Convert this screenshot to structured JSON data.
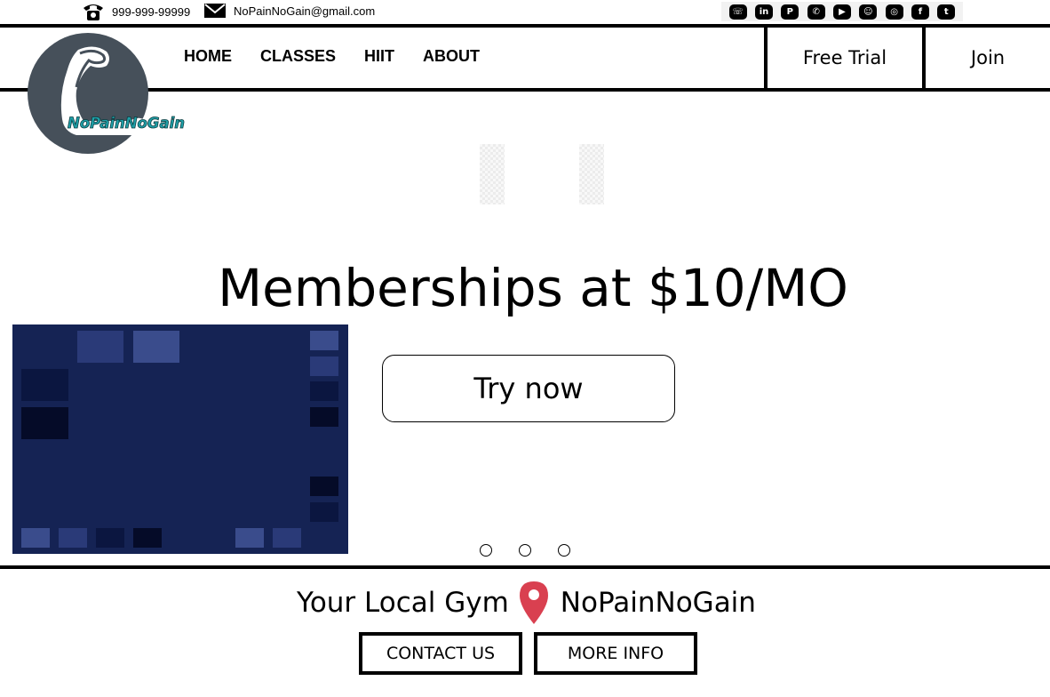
{
  "contact": {
    "phone": "999-999-99999",
    "email": "NoPainNoGain@gmail.com"
  },
  "social_icons": [
    "viber-icon",
    "linkedin-icon",
    "pinterest-icon",
    "whatsapp-icon",
    "youtube-icon",
    "snapchat-icon",
    "instagram-icon",
    "facebook-icon",
    "twitter-icon"
  ],
  "logo": {
    "text": "NoPainNoGain"
  },
  "nav": {
    "items": [
      {
        "label": "HOME"
      },
      {
        "label": "CLASSES"
      },
      {
        "label": "HIIT"
      },
      {
        "label": "ABOUT"
      }
    ]
  },
  "header_buttons": {
    "free_trial": "Free Trial",
    "join": "Join"
  },
  "hero": {
    "title": "Memberships at $10/MO",
    "cta": "Try now",
    "slides": 3
  },
  "location": {
    "prefix": "Your Local Gym",
    "name": "NoPainNoGain"
  },
  "footer_buttons": {
    "contact": "CONTACT US",
    "more_info": "MORE INFO"
  },
  "colors": {
    "hero_image_bg": "#152354",
    "logo_circle": "#46505a",
    "logo_text": "#1fa0a8",
    "pin": "#d94050"
  }
}
